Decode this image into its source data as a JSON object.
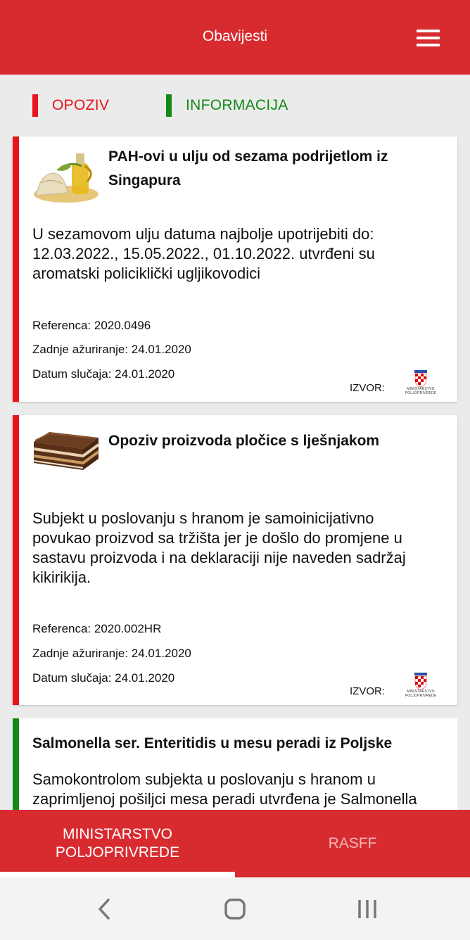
{
  "header": {
    "title": "Obavijesti",
    "menu_icon": "hamburger-icon"
  },
  "legend": {
    "opoziv": {
      "label": "OPOZIV",
      "color": "#e8141c"
    },
    "informacija": {
      "label": "INFORMACIJA",
      "color": "#138a16"
    }
  },
  "cards": [
    {
      "type": "opoziv",
      "title": "PAH-ovi u ulju od sezama podrijetlom iz Singapura",
      "body": "U sezamovom ulju datuma najbolje upotrijebiti do: 12.03.2022., 15.05.2022., 01.10.2022. utvrđeni su aromatski policiklički ugljikovodici",
      "referenca": "Referenca: 2020.0496",
      "azurirano": "Zadnje ažuriranje: 24.01.2020",
      "datum": "Datum slučaja: 24.01.2020",
      "izvor": "IZVOR:",
      "source_logo_text": "MINISTARSTVO POLJOPRIVREDE"
    },
    {
      "type": "opoziv",
      "title": "Opoziv proizvoda pločice s lješnjakom",
      "body": "Subjekt u poslovanju s hranom je samoinicijativno povukao proizvod sa tržišta jer je došlo do promjene u sastavu proizvoda i na deklaraciji nije naveden sadržaj kikirikija.",
      "referenca": "Referenca: 2020.002HR",
      "azurirano": "Zadnje ažuriranje: 24.01.2020",
      "datum": "Datum slučaja: 24.01.2020",
      "izvor": "IZVOR:",
      "source_logo_text": "MINISTARSTVO POLJOPRIVREDE"
    },
    {
      "type": "informacija",
      "title": "Salmonella ser. Enteritidis u mesu peradi iz Poljske",
      "body": "Samokontrolom subjekta u poslovanju s hranom u zaprimljenoj pošiljci mesa peradi utvrđena je Salmonella"
    }
  ],
  "bottom_tabs": [
    {
      "label": "MINISTARSTVO POLJOPRIVREDE",
      "active": true
    },
    {
      "label": "RASFF",
      "active": false
    }
  ],
  "system_nav": {
    "back": "back-icon",
    "home": "home-icon",
    "recents": "recents-icon"
  }
}
